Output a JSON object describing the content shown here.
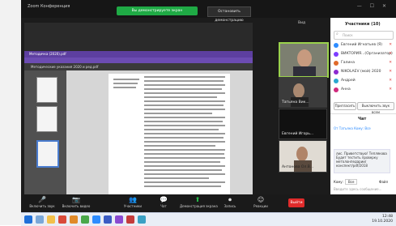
{
  "zoom": {
    "window_title": "Zoom Конференция",
    "share_banner": "Вы демонстрируете экран",
    "stop_share": "Остановить демонстрацию",
    "view_label": "Вид",
    "participants_title": "Участники (10)",
    "search_placeholder": "Поиск",
    "participants": [
      {
        "name": "Евгений Игнатьев (Я)",
        "color": "#2d8cff"
      },
      {
        "name": "ВИКТОРИЯ...(Организатор)",
        "color": "#7d3cff"
      },
      {
        "name": "Галина",
        "color": "#e06a2a"
      },
      {
        "name": "NIKOLAEV (мой) 2020",
        "color": "#8c2ad0"
      },
      {
        "name": "Андрей",
        "color": "#2aa7d0"
      },
      {
        "name": "Анна",
        "color": "#d02a7d"
      }
    ],
    "invite_label": "Пригласить",
    "mute_all_label": "Выключить звук всем",
    "chat_title": "Чат",
    "chat_from": "От Татьяна Кому: Все",
    "chat_text": "лис. Приветствую! Теплякова Будет тестить проверку метолонпедарии/конспект/pdf/2018",
    "chat_to_label": "Кому:",
    "chat_to_value": "Все",
    "chat_file_label": "Файл",
    "chat_input_placeholder": "Введите здесь сообщение...",
    "tiles": [
      {
        "name": ""
      },
      {
        "name": "Татьяна Вик..."
      },
      {
        "name": "Евгений Игорь..."
      },
      {
        "name": "Антонова Ол.В..."
      }
    ],
    "end_label": "Выйти",
    "toolbar": [
      {
        "label": "Включить звук",
        "icon": "microphone-icon",
        "glyph": "🎤"
      },
      {
        "label": "Включить видео",
        "icon": "camera-icon",
        "glyph": "📷"
      },
      {
        "label": "Участники",
        "icon": "participants-icon",
        "glyph": "👥"
      },
      {
        "label": "Чат",
        "icon": "chat-icon",
        "glyph": "💬"
      },
      {
        "label": "Демонстрация экрана",
        "icon": "share-screen-icon",
        "glyph": "⬆"
      },
      {
        "label": "Запись",
        "icon": "record-icon",
        "glyph": "⏺"
      },
      {
        "label": "Реакции",
        "icon": "reactions-icon",
        "glyph": "☺"
      }
    ]
  },
  "browser": {
    "tab_title": "Методичка (2020).pdf",
    "toolbar_text": "Методические указания 2020 и ред.pdf"
  },
  "taskbar": {
    "time": "12:48",
    "date": "19.10.2020"
  }
}
